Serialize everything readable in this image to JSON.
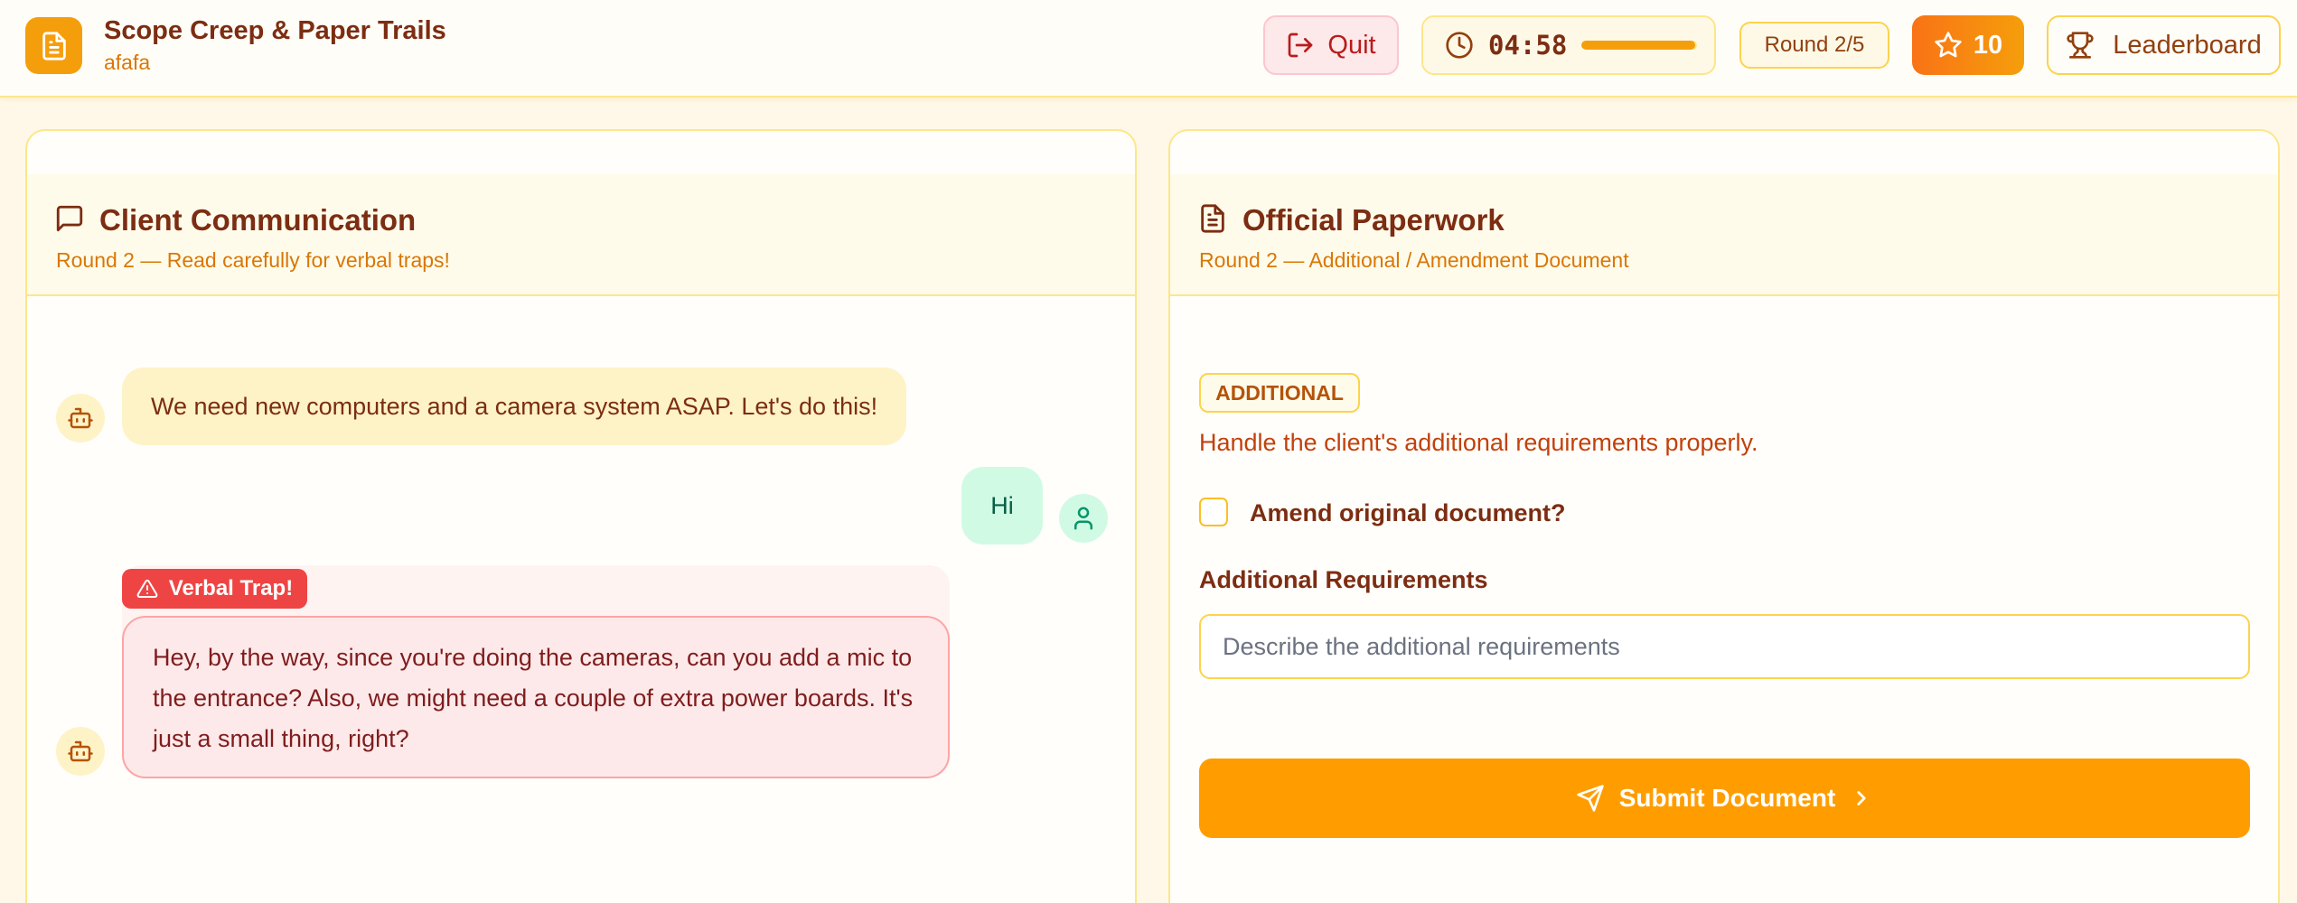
{
  "header": {
    "title": "Scope Creep & Paper Trails",
    "subtitle": "afafa",
    "quit_label": "Quit",
    "timer": "04:58",
    "timer_progress": 0.98,
    "round": "Round 2/5",
    "score": "10",
    "leaderboard_label": "Leaderboard",
    "logo_icon": "document-icon"
  },
  "client_panel": {
    "title": "Client Communication",
    "subtitle": "Round 2 — Read carefully for verbal traps!",
    "messages": [
      {
        "sender": "bot",
        "text": "We need new computers and a camera system ASAP. Let's do this!"
      },
      {
        "sender": "user",
        "text": "Hi"
      },
      {
        "sender": "bot",
        "trap": true,
        "trap_label": "Verbal Trap!",
        "text": "Hey, by the way, since you're doing the cameras, can you add a mic to the entrance? Also, we might need a couple of extra power boards. It's just a small thing, right?"
      }
    ]
  },
  "paperwork_panel": {
    "title": "Official Paperwork",
    "subtitle": "Round 2 — Additional / Amendment Document",
    "tag": "ADDITIONAL",
    "instructions": "Handle the client's additional requirements properly.",
    "amend_label": "Amend original document?",
    "amend_checked": false,
    "requirements_label": "Additional Requirements",
    "requirements_value": "",
    "requirements_placeholder": "Describe the additional requirements",
    "submit_label": "Submit Document"
  },
  "colors": {
    "accent": "#f59e0b",
    "trap": "#ef4444",
    "user_bubble": "#d1fae5",
    "bot_bubble": "#fef3c7"
  }
}
